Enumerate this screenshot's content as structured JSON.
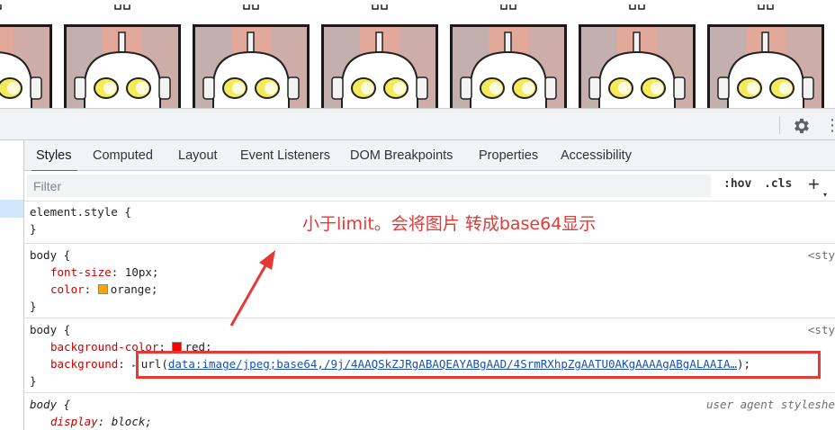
{
  "preview": {
    "tile_count": 7,
    "colors": {
      "tile_bg": "#e2a89a",
      "tile_border": "#1a1a1a",
      "face": "#ffffff",
      "eye_glow": "#f5ea5a",
      "shade": "#a8b4c0"
    }
  },
  "toolbar": {
    "settings_icon": "gear-icon",
    "more_icon": "kebab-menu-icon",
    "more_glyph": "⋮"
  },
  "tabs": [
    {
      "label": "Styles",
      "active": true
    },
    {
      "label": "Computed",
      "active": false
    },
    {
      "label": "Layout",
      "active": false
    },
    {
      "label": "Event Listeners",
      "active": false
    },
    {
      "label": "DOM Breakpoints",
      "active": false
    },
    {
      "label": "Properties",
      "active": false
    },
    {
      "label": "Accessibility",
      "active": false
    }
  ],
  "filter": {
    "placeholder": "Filter",
    "value": "",
    "hov_label": ":hov",
    "cls_label": ".cls",
    "plus_label": "+",
    "plus_dropdown": "▾"
  },
  "rules": {
    "element_style": {
      "selector": "element.style {",
      "close": "}"
    },
    "body1": {
      "selector": "body {",
      "source": "<sty",
      "props": [
        {
          "name": "font-size",
          "value": "10px;"
        },
        {
          "name": "color",
          "value": "orange;",
          "swatch": "#ffa500"
        }
      ],
      "close": "}"
    },
    "body2": {
      "selector": "body {",
      "source": "<sty",
      "props": [
        {
          "name": "background-color",
          "value": "red;",
          "swatch": "#ff0000"
        },
        {
          "name": "background",
          "prefix": "url(",
          "link": "data:image/jpeg;base64,/9j/4AAQSkZJRgABAQEAYABgAAD/4SrmRXhpZgAATU0AKgAAAAgABgALAAIA…",
          "suffix": ");"
        }
      ],
      "close": "}"
    },
    "body3": {
      "selector": "body {",
      "source": "user agent styleshe",
      "props": [
        {
          "name": "display",
          "value": "block;"
        }
      ]
    }
  },
  "annotation": {
    "text": "小于limit。会将图片 转成base64显示",
    "color": "#e53935"
  }
}
